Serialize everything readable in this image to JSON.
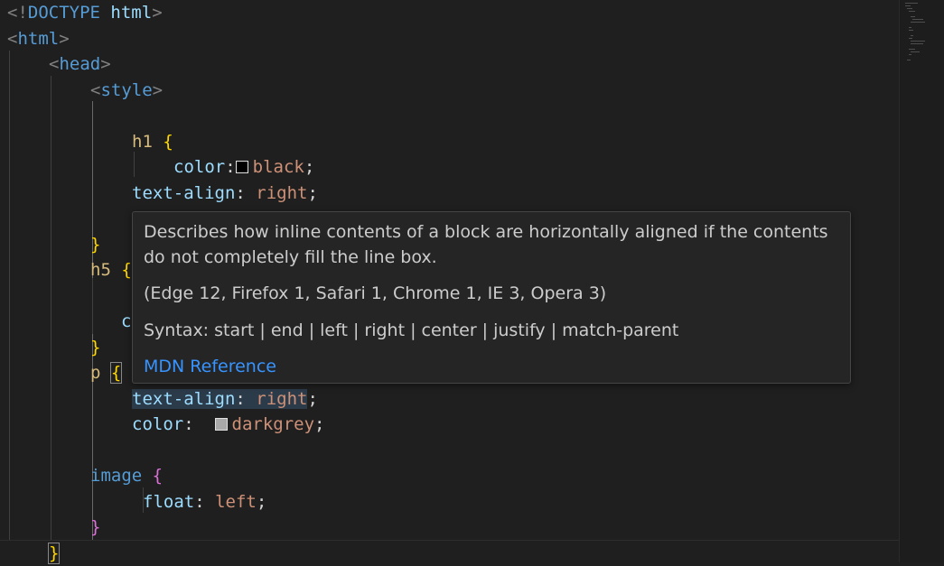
{
  "editor": {
    "lines": [
      {
        "tokens": [
          {
            "t": "<!",
            "c": "punct"
          },
          {
            "t": "DOCTYPE",
            "c": "tag"
          },
          {
            "t": " ",
            "c": "plain"
          },
          {
            "t": "html",
            "c": "prop"
          },
          {
            "t": ">",
            "c": "punct"
          }
        ]
      },
      {
        "tokens": [
          {
            "t": "<",
            "c": "punct"
          },
          {
            "t": "html",
            "c": "tag"
          },
          {
            "t": ">",
            "c": "punct"
          }
        ]
      },
      {
        "tokens": [
          {
            "t": "<",
            "c": "punct"
          },
          {
            "t": "head",
            "c": "tag"
          },
          {
            "t": ">",
            "c": "punct"
          }
        ]
      },
      {
        "tokens": [
          {
            "t": "<",
            "c": "punct"
          },
          {
            "t": "style",
            "c": "tag"
          },
          {
            "t": ">",
            "c": "punct"
          }
        ]
      },
      {
        "tokens": []
      },
      {
        "tokens": [
          {
            "t": "h1",
            "c": "sel"
          },
          {
            "t": " ",
            "c": "plain"
          },
          {
            "t": "{",
            "c": "b1"
          }
        ]
      },
      {
        "tokens": [
          {
            "t": "color",
            "c": "prop"
          },
          {
            "t": ":",
            "c": "plain"
          },
          {
            "t": "",
            "c": "swatch",
            "color": "#000000"
          },
          {
            "t": "black",
            "c": "val"
          },
          {
            "t": ";",
            "c": "plain"
          }
        ]
      },
      {
        "tokens": [
          {
            "t": "text-align",
            "c": "prop"
          },
          {
            "t": ": ",
            "c": "plain"
          },
          {
            "t": "right",
            "c": "val"
          },
          {
            "t": ";",
            "c": "plain"
          }
        ]
      },
      {
        "tokens": []
      },
      {
        "tokens": [
          {
            "t": "}",
            "c": "b1"
          }
        ]
      },
      {
        "tokens": [
          {
            "t": "h5",
            "c": "sel"
          },
          {
            "t": " ",
            "c": "plain"
          },
          {
            "t": "{",
            "c": "b1"
          }
        ]
      },
      {
        "tokens": []
      },
      {
        "tokens": [
          {
            "t": "c",
            "c": "prop"
          }
        ]
      },
      {
        "tokens": [
          {
            "t": "}",
            "c": "b1"
          }
        ]
      },
      {
        "tokens": [
          {
            "t": "p",
            "c": "sel"
          },
          {
            "t": " ",
            "c": "plain"
          },
          {
            "t": "{",
            "c": "b1",
            "match": true
          }
        ]
      },
      {
        "tokens": [
          {
            "t": "text-align",
            "c": "prop",
            "hl": true
          },
          {
            "t": ": ",
            "c": "plain",
            "hl": true
          },
          {
            "t": "right",
            "c": "val",
            "hl": true
          },
          {
            "t": ";",
            "c": "plain"
          }
        ]
      },
      {
        "tokens": [
          {
            "t": "color",
            "c": "prop"
          },
          {
            "t": ":  ",
            "c": "plain"
          },
          {
            "t": "",
            "c": "swatch",
            "color": "#a9a9a9"
          },
          {
            "t": "darkgrey",
            "c": "val"
          },
          {
            "t": ";",
            "c": "plain"
          }
        ]
      },
      {
        "tokens": []
      },
      {
        "tokens": [
          {
            "t": "image",
            "c": "tag"
          },
          {
            "t": " ",
            "c": "plain"
          },
          {
            "t": "{",
            "c": "b2"
          }
        ]
      },
      {
        "tokens": [
          {
            "t": "float",
            "c": "prop"
          },
          {
            "t": ": ",
            "c": "plain"
          },
          {
            "t": "left",
            "c": "val"
          },
          {
            "t": ";",
            "c": "plain"
          }
        ]
      },
      {
        "tokens": [
          {
            "t": "}",
            "c": "b2"
          }
        ]
      },
      {
        "tokens": [
          {
            "t": "}",
            "c": "b1",
            "match": true
          }
        ]
      }
    ]
  },
  "hover": {
    "description": "Describes how inline contents of a block are horizontally aligned if the contents do not completely fill the line box.",
    "browsers": "(Edge 12, Firefox 1, Safari 1, Chrome 1, IE 3, Opera 3)",
    "syntax": "Syntax: start | end | left | right | center | justify | match-parent",
    "link_label": "MDN Reference"
  },
  "colors": {
    "background": "#1f1f1f",
    "tag": "#569cd6",
    "selector": "#d7ba7d",
    "property": "#9cdcfe",
    "value": "#ce9178",
    "bracket_level1": "#ffd700",
    "bracket_level2": "#da70d6",
    "link": "#3794ff"
  }
}
